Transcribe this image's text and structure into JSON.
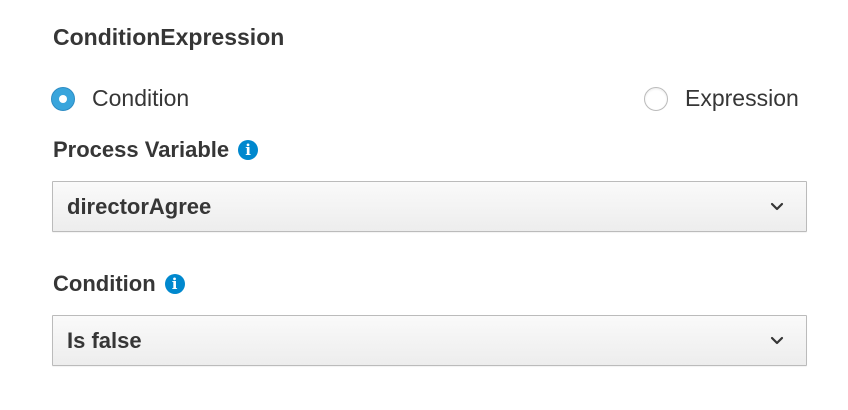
{
  "section": {
    "title": "ConditionExpression"
  },
  "radio_group": {
    "options": [
      {
        "label": "Condition",
        "checked": true
      },
      {
        "label": "Expression",
        "checked": false
      }
    ]
  },
  "process_variable": {
    "label": "Process Variable",
    "info_icon": "info-circle-icon",
    "selected_value": "directorAgree"
  },
  "condition": {
    "label": "Condition",
    "info_icon": "info-circle-icon",
    "selected_value": "Is false"
  },
  "colors": {
    "accent": "#39a5dc",
    "info": "#0088ce",
    "text": "#363636"
  }
}
